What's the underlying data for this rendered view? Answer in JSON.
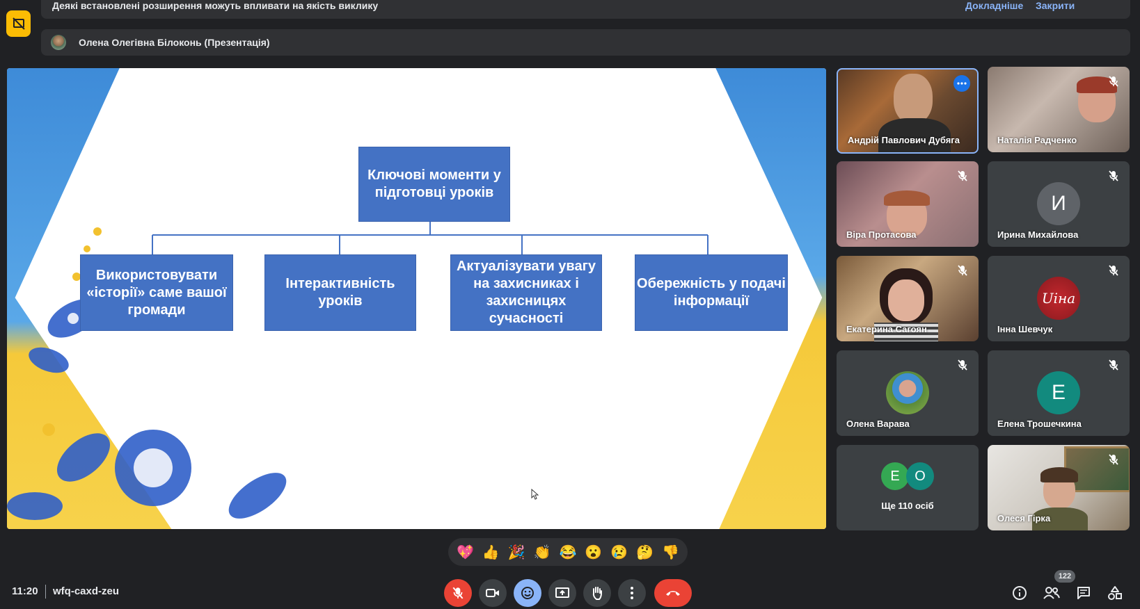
{
  "banner": {
    "text": "Деякі встановлені розширення можуть впливати на якість виклику",
    "learn_more": "Докладніше",
    "close": "Закрити"
  },
  "presenter": {
    "label": "Олена Олегівна Білоконь (Презентація)"
  },
  "slide": {
    "root": "Ключові моменти у підготовці уроків",
    "boxes": [
      "Використовувати «історії» саме вашої громади",
      "Інтерактивність уроків",
      "Актуалізувати увагу на захисниках і захисницях сучасності",
      "Обережність у подачі інформації"
    ]
  },
  "participants": [
    {
      "name": "Андрій Павлович Дубяга",
      "type": "video",
      "active": true
    },
    {
      "name": "Наталія Радченко",
      "type": "video",
      "muted": true
    },
    {
      "name": "Віра Протасова",
      "type": "video",
      "muted": true
    },
    {
      "name": "Ирина Михайлова",
      "type": "initial",
      "initial": "И",
      "color": "#5f6368",
      "muted": true
    },
    {
      "name": "Екатерина Сагоян",
      "type": "video",
      "muted": true
    },
    {
      "name": "Інна Шевчук",
      "type": "logo",
      "logo_text": "Uiна",
      "muted": true
    },
    {
      "name": "Олена Варава",
      "type": "photo",
      "muted": true
    },
    {
      "name": "Елена Трошечкина",
      "type": "initial",
      "initial": "Е",
      "color": "#128a7e",
      "muted": true
    },
    {
      "name": "Олеся Гірка",
      "type": "video",
      "muted": true
    }
  ],
  "more": {
    "label": "Ще 110 осіб",
    "initials": [
      "Е",
      "О"
    ],
    "colors": [
      "#34a853",
      "#128a7e"
    ]
  },
  "reactions": [
    "💖",
    "👍",
    "🎉",
    "👏",
    "😂",
    "😮",
    "😢",
    "🤔",
    "👎"
  ],
  "meeting": {
    "time": "11:20",
    "code": "wfq-caxd-zeu"
  },
  "controls": [
    "mic-off",
    "camera",
    "reactions",
    "present",
    "raise-hand",
    "more-options",
    "leave-call"
  ],
  "people_count": "122",
  "colors": {
    "background": "#202124",
    "surface": "#303134",
    "tile": "#3c4043",
    "accent": "#8ab4f8",
    "danger": "#ea4335",
    "warning": "#fbbc04",
    "slide_box": "#4472c4"
  }
}
